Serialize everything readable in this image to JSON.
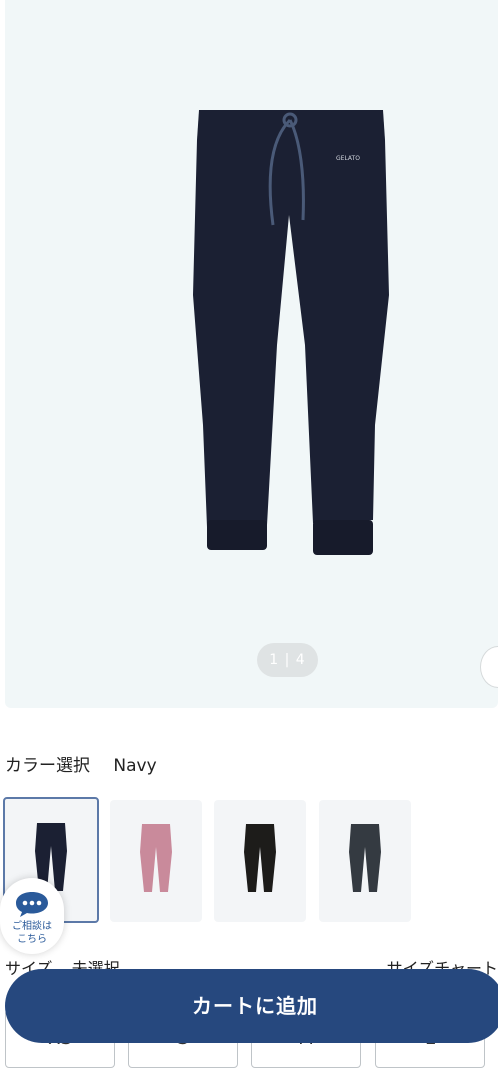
{
  "product": {
    "image_pager": "1 | 4",
    "brand_tag": "GELATO",
    "main_color": "#1b2033"
  },
  "color_select": {
    "label": "カラー選択",
    "selected": "Navy",
    "swatches": [
      {
        "name": "navy",
        "color": "#1b2033",
        "selected": true
      },
      {
        "name": "pink",
        "color": "#c98a9b",
        "selected": false
      },
      {
        "name": "black",
        "color": "#1d1c1a",
        "selected": false
      },
      {
        "name": "charcoal",
        "color": "#343a41",
        "selected": false
      }
    ]
  },
  "chat": {
    "label": "ご相談は\nこちら"
  },
  "size": {
    "label": "サイズ",
    "value": "未選択",
    "chart_link": "サイズチャート",
    "options": [
      "XS",
      "S",
      "M",
      "L"
    ]
  },
  "cart_button": "カートに追加"
}
